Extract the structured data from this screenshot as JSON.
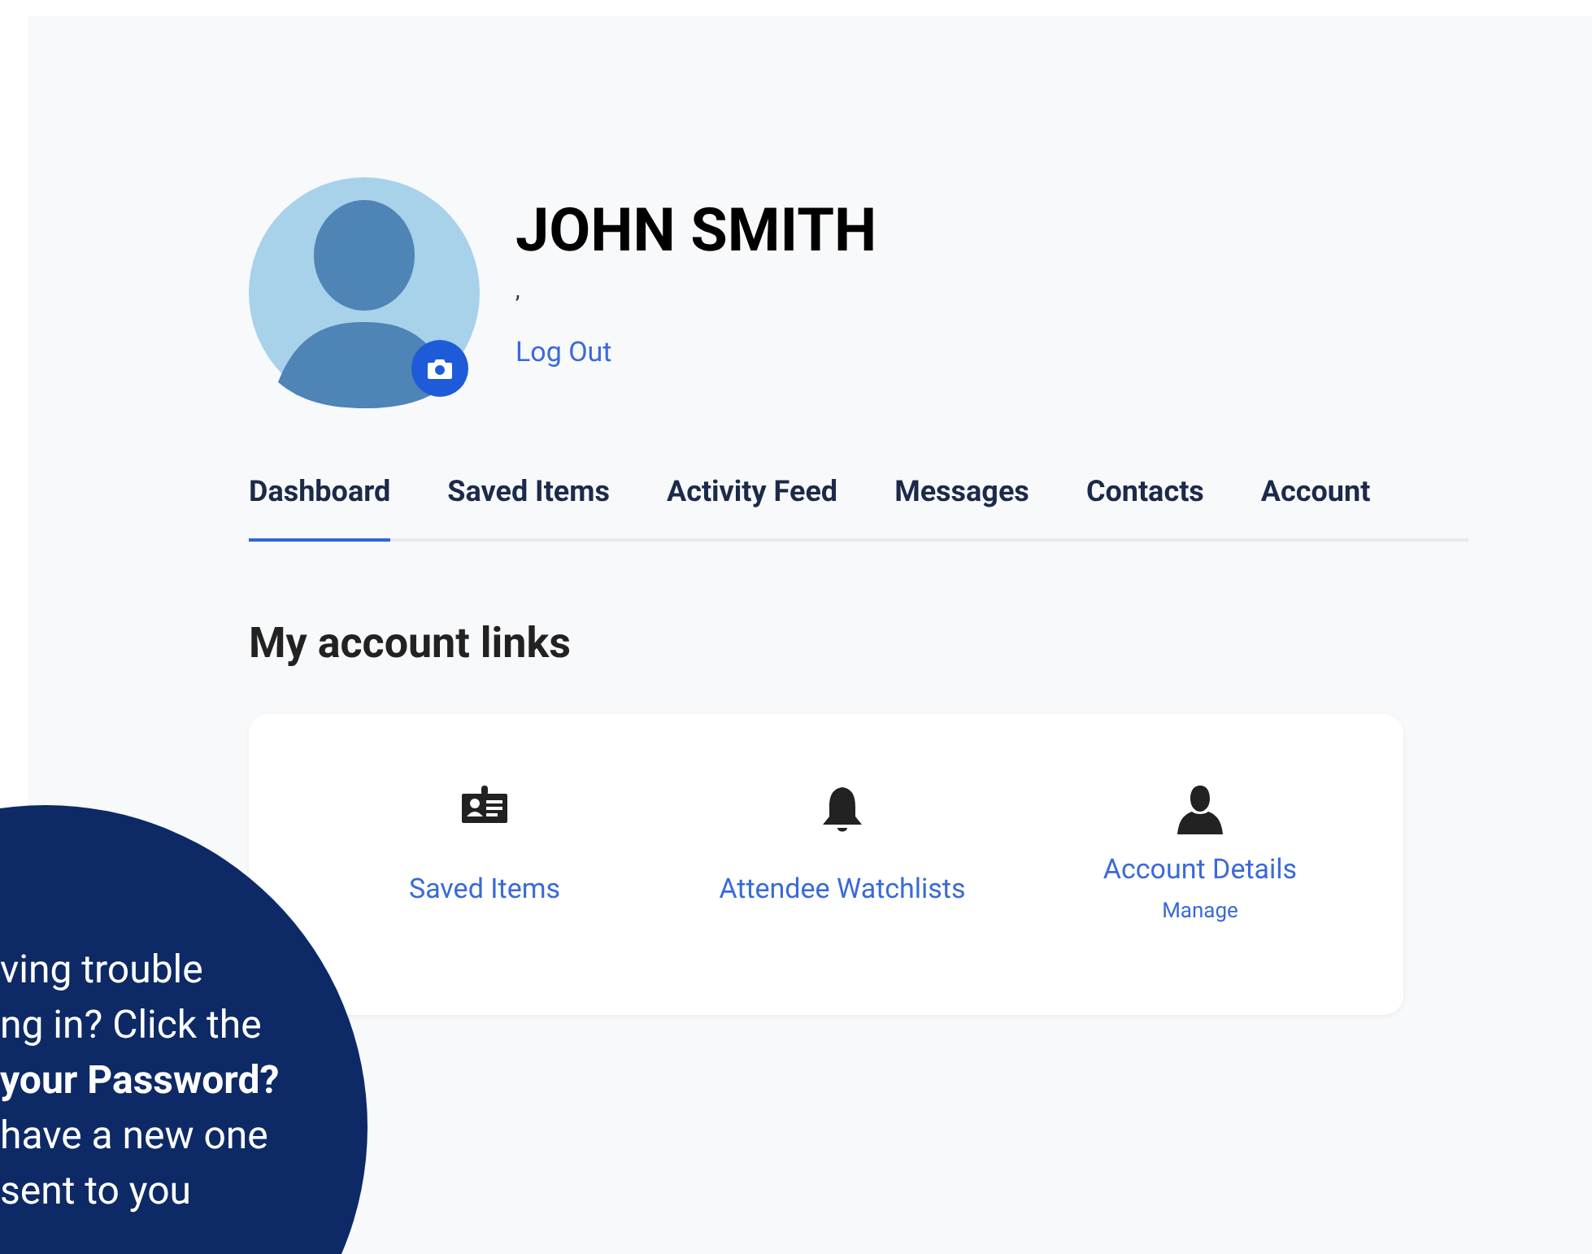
{
  "profile": {
    "name": "JOHN SMITH",
    "subtitle": ",",
    "logout": "Log Out"
  },
  "tabs": [
    {
      "label": "Dashboard",
      "selected": true
    },
    {
      "label": "Saved Items",
      "selected": false
    },
    {
      "label": "Activity Feed",
      "selected": false
    },
    {
      "label": "Messages",
      "selected": false
    },
    {
      "label": "Contacts",
      "selected": false
    },
    {
      "label": "Account",
      "selected": false
    }
  ],
  "section_title": "My account links",
  "links": [
    {
      "kind": "badge",
      "label": "Saved Items"
    },
    {
      "kind": "bell",
      "label": "Attendee Watchlists"
    },
    {
      "kind": "person",
      "label": "Account Details",
      "sublabel": "Manage"
    }
  ],
  "help_bubble": {
    "lines": [
      "ving trouble",
      "ng in? Click the",
      "**your Password?**",
      "have a new one",
      "sent to you"
    ]
  }
}
